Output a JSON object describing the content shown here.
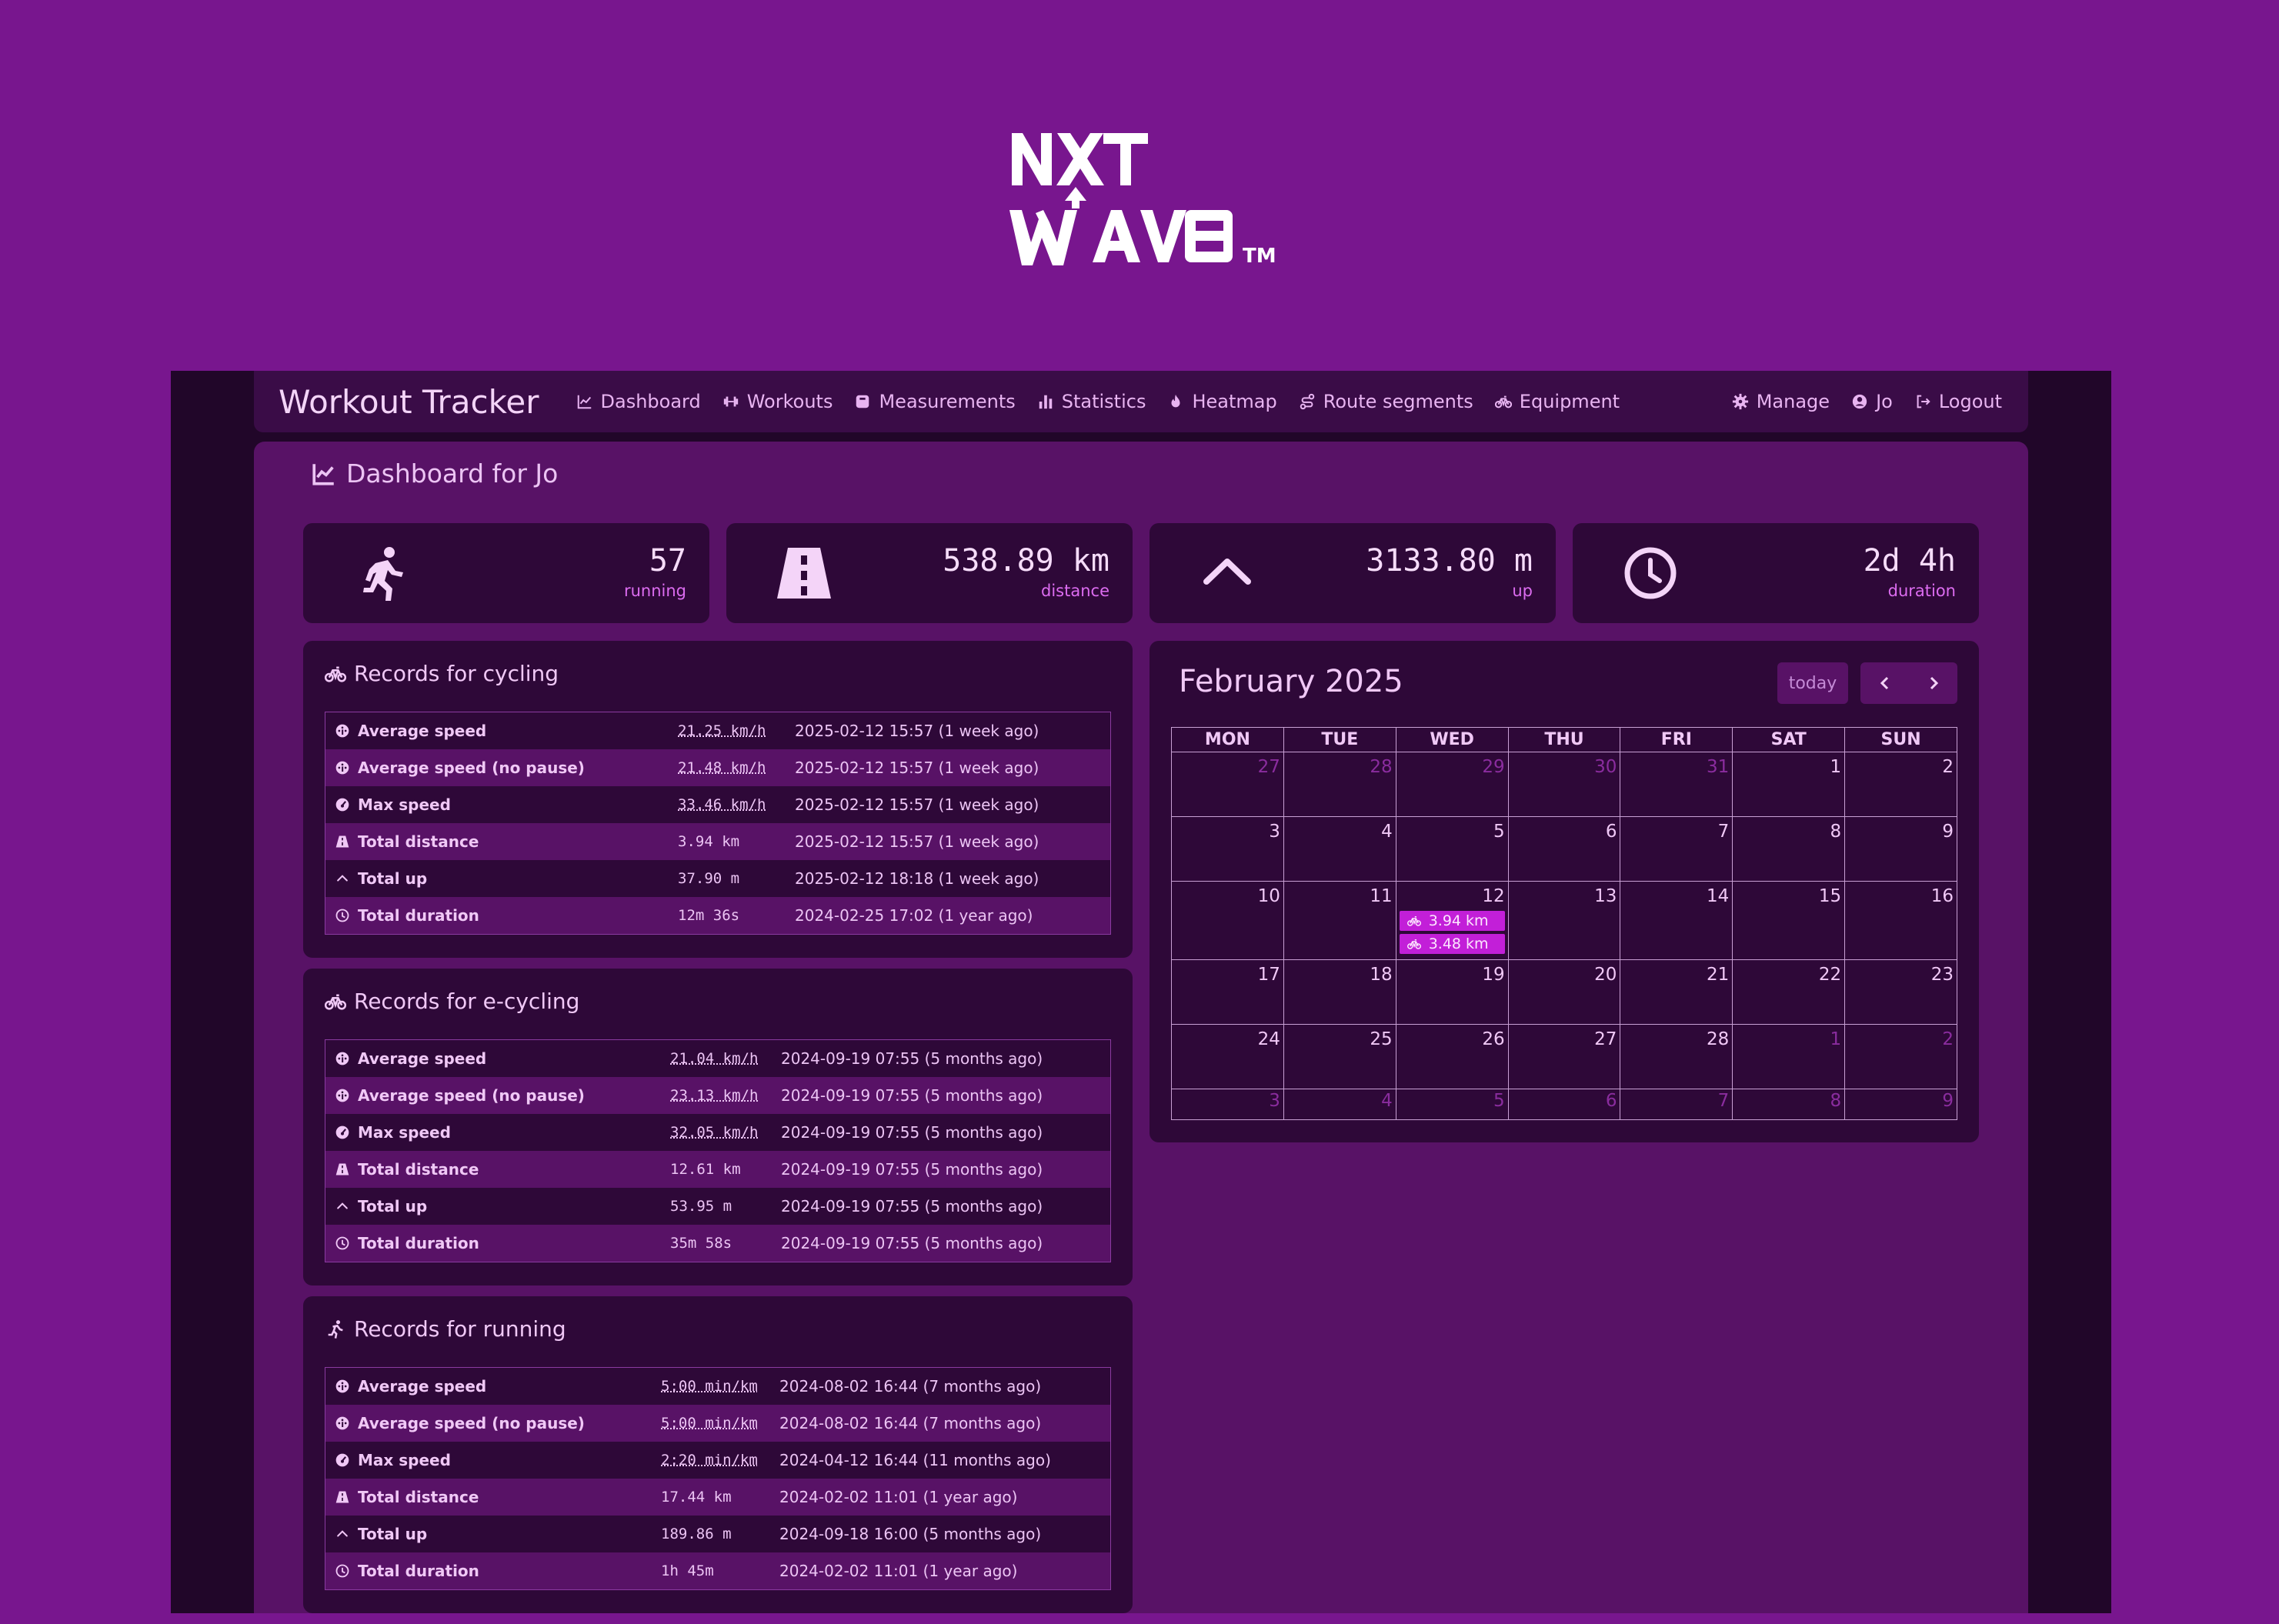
{
  "logo": {
    "line1": "NXT",
    "line2": "WAVE",
    "tm": "TM"
  },
  "navbar": {
    "brand": "Workout Tracker",
    "items": [
      {
        "label": "Dashboard",
        "icon": "chart-line-icon"
      },
      {
        "label": "Workouts",
        "icon": "dumbbell-icon"
      },
      {
        "label": "Measurements",
        "icon": "weight-scale-icon"
      },
      {
        "label": "Statistics",
        "icon": "bar-chart-icon"
      },
      {
        "label": "Heatmap",
        "icon": "fire-icon"
      },
      {
        "label": "Route segments",
        "icon": "route-icon"
      },
      {
        "label": "Equipment",
        "icon": "bicycle-icon"
      }
    ],
    "right": [
      {
        "label": "Manage",
        "icon": "gear-icon"
      },
      {
        "label": "Jo",
        "icon": "user-circle-icon"
      },
      {
        "label": "Logout",
        "icon": "logout-icon"
      }
    ]
  },
  "page_title": "Dashboard for Jo",
  "stats": [
    {
      "value": "57",
      "label": "running",
      "icon": "running-person-icon"
    },
    {
      "value": "538.89 km",
      "label": "distance",
      "icon": "road-icon"
    },
    {
      "value": "3133.80 m",
      "label": "up",
      "icon": "chevron-up-icon"
    },
    {
      "value": "2d 4h",
      "label": "duration",
      "icon": "clock-icon"
    }
  ],
  "records": [
    {
      "title": "Records for cycling",
      "icon": "bicycle-icon",
      "rows": [
        {
          "name": "Average speed",
          "value": "21.25 km/h",
          "date": "2025-02-12 15:57 (1 week ago)",
          "icon": "gauge-icon",
          "link": true
        },
        {
          "name": "Average speed (no pause)",
          "value": "21.48 km/h",
          "date": "2025-02-12 15:57 (1 week ago)",
          "icon": "gauge-icon",
          "link": true
        },
        {
          "name": "Max speed",
          "value": "33.46 km/h",
          "date": "2025-02-12 15:57 (1 week ago)",
          "icon": "speedometer-icon",
          "link": true
        },
        {
          "name": "Total distance",
          "value": "3.94 km",
          "date": "2025-02-12 15:57 (1 week ago)",
          "icon": "road-icon",
          "link": false
        },
        {
          "name": "Total up",
          "value": "37.90 m",
          "date": "2025-02-12 18:18 (1 week ago)",
          "icon": "chevron-up-icon",
          "link": false
        },
        {
          "name": "Total duration",
          "value": "12m 36s",
          "date": "2024-02-25 17:02 (1 year ago)",
          "icon": "clock-icon",
          "link": false
        }
      ]
    },
    {
      "title": "Records for e-cycling",
      "icon": "bicycle-icon",
      "rows": [
        {
          "name": "Average speed",
          "value": "21.04 km/h",
          "date": "2024-09-19 07:55 (5 months ago)",
          "icon": "gauge-icon",
          "link": true
        },
        {
          "name": "Average speed (no pause)",
          "value": "23.13 km/h",
          "date": "2024-09-19 07:55 (5 months ago)",
          "icon": "gauge-icon",
          "link": true
        },
        {
          "name": "Max speed",
          "value": "32.05 km/h",
          "date": "2024-09-19 07:55 (5 months ago)",
          "icon": "speedometer-icon",
          "link": true
        },
        {
          "name": "Total distance",
          "value": "12.61 km",
          "date": "2024-09-19 07:55 (5 months ago)",
          "icon": "road-icon",
          "link": false
        },
        {
          "name": "Total up",
          "value": "53.95 m",
          "date": "2024-09-19 07:55 (5 months ago)",
          "icon": "chevron-up-icon",
          "link": false
        },
        {
          "name": "Total duration",
          "value": "35m 58s",
          "date": "2024-09-19 07:55 (5 months ago)",
          "icon": "clock-icon",
          "link": false
        }
      ]
    },
    {
      "title": "Records for running",
      "icon": "running-person-icon",
      "rows": [
        {
          "name": "Average speed",
          "value": "5:00 min/km",
          "date": "2024-08-02 16:44 (7 months ago)",
          "icon": "gauge-icon",
          "link": true
        },
        {
          "name": "Average speed (no pause)",
          "value": "5:00 min/km",
          "date": "2024-08-02 16:44 (7 months ago)",
          "icon": "gauge-icon",
          "link": true
        },
        {
          "name": "Max speed",
          "value": "2:20 min/km",
          "date": "2024-04-12 16:44 (11 months ago)",
          "icon": "speedometer-icon",
          "link": true
        },
        {
          "name": "Total distance",
          "value": "17.44 km",
          "date": "2024-02-02 11:01 (1 year ago)",
          "icon": "road-icon",
          "link": false
        },
        {
          "name": "Total up",
          "value": "189.86 m",
          "date": "2024-09-18 16:00 (5 months ago)",
          "icon": "chevron-up-icon",
          "link": false
        },
        {
          "name": "Total duration",
          "value": "1h 45m",
          "date": "2024-02-02 11:01 (1 year ago)",
          "icon": "clock-icon",
          "link": false
        }
      ]
    }
  ],
  "calendar": {
    "title": "February 2025",
    "today_label": "today",
    "prev_icon": "chevron-left-icon",
    "next_icon": "chevron-right-icon",
    "weekdays": [
      "MON",
      "TUE",
      "WED",
      "THU",
      "FRI",
      "SAT",
      "SUN"
    ],
    "weeks": [
      [
        {
          "d": "27",
          "o": true
        },
        {
          "d": "28",
          "o": true
        },
        {
          "d": "29",
          "o": true
        },
        {
          "d": "30",
          "o": true
        },
        {
          "d": "31",
          "o": true
        },
        {
          "d": "1"
        },
        {
          "d": "2"
        }
      ],
      [
        {
          "d": "3"
        },
        {
          "d": "4"
        },
        {
          "d": "5"
        },
        {
          "d": "6"
        },
        {
          "d": "7"
        },
        {
          "d": "8"
        },
        {
          "d": "9"
        }
      ],
      [
        {
          "d": "10"
        },
        {
          "d": "11"
        },
        {
          "d": "12",
          "events": [
            "3.94 km",
            "3.48 km"
          ]
        },
        {
          "d": "13"
        },
        {
          "d": "14"
        },
        {
          "d": "15"
        },
        {
          "d": "16"
        }
      ],
      [
        {
          "d": "17"
        },
        {
          "d": "18"
        },
        {
          "d": "19"
        },
        {
          "d": "20"
        },
        {
          "d": "21"
        },
        {
          "d": "22"
        },
        {
          "d": "23"
        }
      ],
      [
        {
          "d": "24"
        },
        {
          "d": "25"
        },
        {
          "d": "26"
        },
        {
          "d": "27"
        },
        {
          "d": "28"
        },
        {
          "d": "1",
          "o": true
        },
        {
          "d": "2",
          "o": true
        }
      ],
      [
        {
          "d": "3",
          "o": true
        },
        {
          "d": "4",
          "o": true
        },
        {
          "d": "5",
          "o": true
        },
        {
          "d": "6",
          "o": true
        },
        {
          "d": "7",
          "o": true
        },
        {
          "d": "8",
          "o": true
        },
        {
          "d": "9",
          "o": true
        }
      ]
    ],
    "event_icon": "bicycle-icon"
  },
  "colors": {
    "page_bg": "#78168e",
    "frame_bg": "#210629",
    "panel_bg": "#581266",
    "card_bg": "#2e0838",
    "accent": "#dc6cf0",
    "event_bg": "#c21fd8"
  }
}
